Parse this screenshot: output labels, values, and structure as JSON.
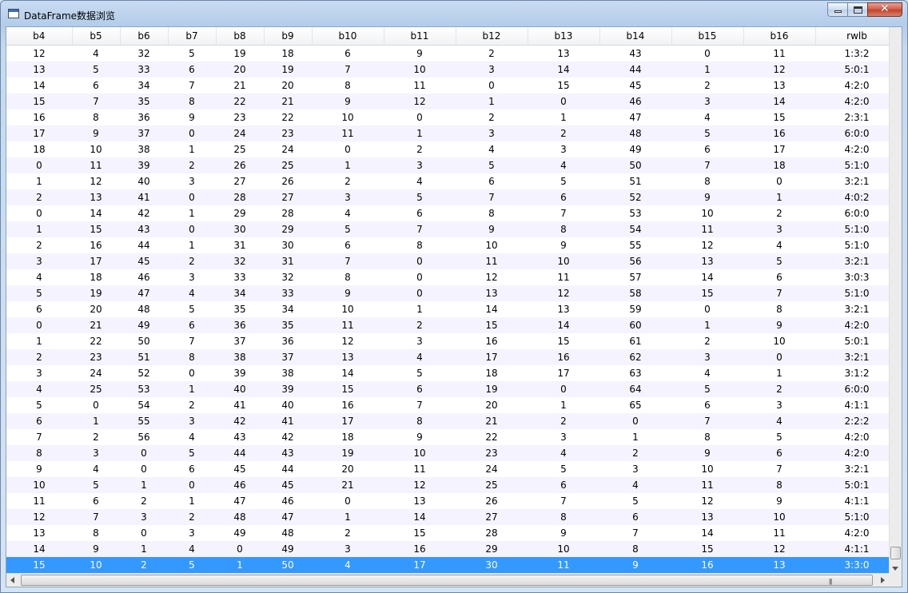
{
  "window": {
    "title": "DataFrame数据浏览"
  },
  "table": {
    "columns": [
      "b4",
      "b5",
      "b6",
      "b7",
      "b8",
      "b9",
      "b10",
      "b11",
      "b12",
      "b13",
      "b14",
      "b15",
      "b16",
      "rwlb"
    ],
    "rows": [
      [
        "12",
        "4",
        "32",
        "5",
        "19",
        "18",
        "6",
        "9",
        "2",
        "13",
        "43",
        "0",
        "11",
        "1:3:2"
      ],
      [
        "13",
        "5",
        "33",
        "6",
        "20",
        "19",
        "7",
        "10",
        "3",
        "14",
        "44",
        "1",
        "12",
        "5:0:1"
      ],
      [
        "14",
        "6",
        "34",
        "7",
        "21",
        "20",
        "8",
        "11",
        "0",
        "15",
        "45",
        "2",
        "13",
        "4:2:0"
      ],
      [
        "15",
        "7",
        "35",
        "8",
        "22",
        "21",
        "9",
        "12",
        "1",
        "0",
        "46",
        "3",
        "14",
        "4:2:0"
      ],
      [
        "16",
        "8",
        "36",
        "9",
        "23",
        "22",
        "10",
        "0",
        "2",
        "1",
        "47",
        "4",
        "15",
        "2:3:1"
      ],
      [
        "17",
        "9",
        "37",
        "0",
        "24",
        "23",
        "11",
        "1",
        "3",
        "2",
        "48",
        "5",
        "16",
        "6:0:0"
      ],
      [
        "18",
        "10",
        "38",
        "1",
        "25",
        "24",
        "0",
        "2",
        "4",
        "3",
        "49",
        "6",
        "17",
        "4:2:0"
      ],
      [
        "0",
        "11",
        "39",
        "2",
        "26",
        "25",
        "1",
        "3",
        "5",
        "4",
        "50",
        "7",
        "18",
        "5:1:0"
      ],
      [
        "1",
        "12",
        "40",
        "3",
        "27",
        "26",
        "2",
        "4",
        "6",
        "5",
        "51",
        "8",
        "0",
        "3:2:1"
      ],
      [
        "2",
        "13",
        "41",
        "0",
        "28",
        "27",
        "3",
        "5",
        "7",
        "6",
        "52",
        "9",
        "1",
        "4:0:2"
      ],
      [
        "0",
        "14",
        "42",
        "1",
        "29",
        "28",
        "4",
        "6",
        "8",
        "7",
        "53",
        "10",
        "2",
        "6:0:0"
      ],
      [
        "1",
        "15",
        "43",
        "0",
        "30",
        "29",
        "5",
        "7",
        "9",
        "8",
        "54",
        "11",
        "3",
        "5:1:0"
      ],
      [
        "2",
        "16",
        "44",
        "1",
        "31",
        "30",
        "6",
        "8",
        "10",
        "9",
        "55",
        "12",
        "4",
        "5:1:0"
      ],
      [
        "3",
        "17",
        "45",
        "2",
        "32",
        "31",
        "7",
        "0",
        "11",
        "10",
        "56",
        "13",
        "5",
        "3:2:1"
      ],
      [
        "4",
        "18",
        "46",
        "3",
        "33",
        "32",
        "8",
        "0",
        "12",
        "11",
        "57",
        "14",
        "6",
        "3:0:3"
      ],
      [
        "5",
        "19",
        "47",
        "4",
        "34",
        "33",
        "9",
        "0",
        "13",
        "12",
        "58",
        "15",
        "7",
        "5:1:0"
      ],
      [
        "6",
        "20",
        "48",
        "5",
        "35",
        "34",
        "10",
        "1",
        "14",
        "13",
        "59",
        "0",
        "8",
        "3:2:1"
      ],
      [
        "0",
        "21",
        "49",
        "6",
        "36",
        "35",
        "11",
        "2",
        "15",
        "14",
        "60",
        "1",
        "9",
        "4:2:0"
      ],
      [
        "1",
        "22",
        "50",
        "7",
        "37",
        "36",
        "12",
        "3",
        "16",
        "15",
        "61",
        "2",
        "10",
        "5:0:1"
      ],
      [
        "2",
        "23",
        "51",
        "8",
        "38",
        "37",
        "13",
        "4",
        "17",
        "16",
        "62",
        "3",
        "0",
        "3:2:1"
      ],
      [
        "3",
        "24",
        "52",
        "0",
        "39",
        "38",
        "14",
        "5",
        "18",
        "17",
        "63",
        "4",
        "1",
        "3:1:2"
      ],
      [
        "4",
        "25",
        "53",
        "1",
        "40",
        "39",
        "15",
        "6",
        "19",
        "0",
        "64",
        "5",
        "2",
        "6:0:0"
      ],
      [
        "5",
        "0",
        "54",
        "2",
        "41",
        "40",
        "16",
        "7",
        "20",
        "1",
        "65",
        "6",
        "3",
        "4:1:1"
      ],
      [
        "6",
        "1",
        "55",
        "3",
        "42",
        "41",
        "17",
        "8",
        "21",
        "2",
        "0",
        "7",
        "4",
        "2:2:2"
      ],
      [
        "7",
        "2",
        "56",
        "4",
        "43",
        "42",
        "18",
        "9",
        "22",
        "3",
        "1",
        "8",
        "5",
        "4:2:0"
      ],
      [
        "8",
        "3",
        "0",
        "5",
        "44",
        "43",
        "19",
        "10",
        "23",
        "4",
        "2",
        "9",
        "6",
        "4:2:0"
      ],
      [
        "9",
        "4",
        "0",
        "6",
        "45",
        "44",
        "20",
        "11",
        "24",
        "5",
        "3",
        "10",
        "7",
        "3:2:1"
      ],
      [
        "10",
        "5",
        "1",
        "0",
        "46",
        "45",
        "21",
        "12",
        "25",
        "6",
        "4",
        "11",
        "8",
        "5:0:1"
      ],
      [
        "11",
        "6",
        "2",
        "1",
        "47",
        "46",
        "0",
        "13",
        "26",
        "7",
        "5",
        "12",
        "9",
        "4:1:1"
      ],
      [
        "12",
        "7",
        "3",
        "2",
        "48",
        "47",
        "1",
        "14",
        "27",
        "8",
        "6",
        "13",
        "10",
        "5:1:0"
      ],
      [
        "13",
        "8",
        "0",
        "3",
        "49",
        "48",
        "2",
        "15",
        "28",
        "9",
        "7",
        "14",
        "11",
        "4:2:0"
      ],
      [
        "14",
        "9",
        "1",
        "4",
        "0",
        "49",
        "3",
        "16",
        "29",
        "10",
        "8",
        "15",
        "12",
        "4:1:1"
      ],
      [
        "15",
        "10",
        "2",
        "5",
        "1",
        "50",
        "4",
        "17",
        "30",
        "11",
        "9",
        "16",
        "13",
        "3:3:0"
      ]
    ],
    "selected_row": 32
  },
  "colors": {
    "selection": "#3399ff",
    "alt_row": "#f5f3ff"
  },
  "icons": {
    "app": "window-icon",
    "minimize": "minimize-icon",
    "maximize": "maximize-icon",
    "close": "close-icon"
  }
}
